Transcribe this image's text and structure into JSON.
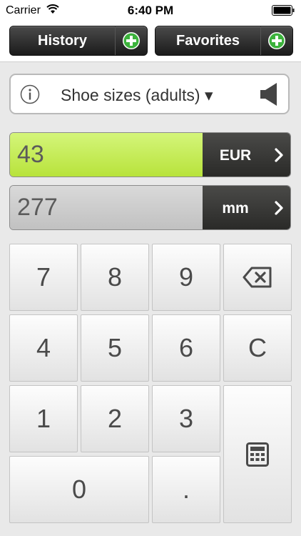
{
  "status_bar": {
    "carrier": "Carrier",
    "time": "6:40 PM"
  },
  "toolbar": {
    "history_label": "History",
    "favorites_label": "Favorites"
  },
  "category": {
    "label": "Shoe sizes (adults) ▾"
  },
  "rows": [
    {
      "value": "43",
      "unit": "EUR"
    },
    {
      "value": "277",
      "unit": "mm"
    }
  ],
  "keypad": {
    "k7": "7",
    "k8": "8",
    "k9": "9",
    "k4": "4",
    "k5": "5",
    "k6": "6",
    "k1": "1",
    "k2": "2",
    "k3": "3",
    "k0": "0",
    "dot": ".",
    "clear": "C"
  },
  "colors": {
    "active_field": "#c6ec59",
    "inactive_field": "#cdcdcd",
    "unit_button": "#3a3a38",
    "plus_green": "#3cb23c"
  },
  "icons": [
    "wifi-icon",
    "battery-icon",
    "plus-icon",
    "info-icon",
    "speaker-icon",
    "chevron-right-icon",
    "backspace-icon",
    "calculator-icon"
  ]
}
